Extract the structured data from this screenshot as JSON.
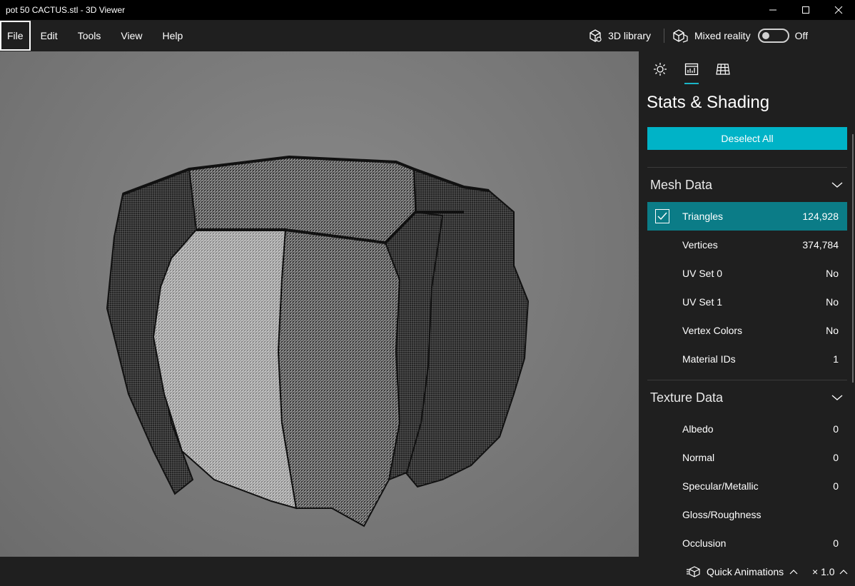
{
  "window": {
    "title": "pot 50 CACTUS.stl - 3D Viewer"
  },
  "menu": {
    "items": [
      {
        "label": "File"
      },
      {
        "label": "Edit"
      },
      {
        "label": "Tools"
      },
      {
        "label": "View"
      },
      {
        "label": "Help"
      }
    ],
    "library_label": "3D library",
    "mixed_reality_label": "Mixed reality",
    "mixed_reality_state": "Off"
  },
  "panel": {
    "tabs": [
      "lighting-icon",
      "stats-icon",
      "grid-icon"
    ],
    "active_tab": "stats-icon",
    "title": "Stats & Shading",
    "deselect_label": "Deselect All",
    "mesh_section": {
      "title": "Mesh Data",
      "rows": [
        {
          "label": "Triangles",
          "value": "124,928",
          "selected": true
        },
        {
          "label": "Vertices",
          "value": "374,784"
        },
        {
          "label": "UV Set 0",
          "value": "No"
        },
        {
          "label": "UV Set 1",
          "value": "No"
        },
        {
          "label": "Vertex Colors",
          "value": "No"
        },
        {
          "label": "Material IDs",
          "value": "1"
        }
      ]
    },
    "texture_section": {
      "title": "Texture Data",
      "rows": [
        {
          "label": "Albedo",
          "value": "0"
        },
        {
          "label": "Normal",
          "value": "0"
        },
        {
          "label": "Specular/Metallic",
          "value": "0"
        },
        {
          "label": "Gloss/Roughness",
          "value": ""
        },
        {
          "label": "Occlusion",
          "value": "0"
        }
      ]
    }
  },
  "status": {
    "quick_animations_label": "Quick Animations",
    "speed_label": "× 1.0"
  },
  "colors": {
    "accent": "#00b3c7",
    "selected_row": "#0b7c87",
    "panel_bg": "#1f1f1f"
  }
}
